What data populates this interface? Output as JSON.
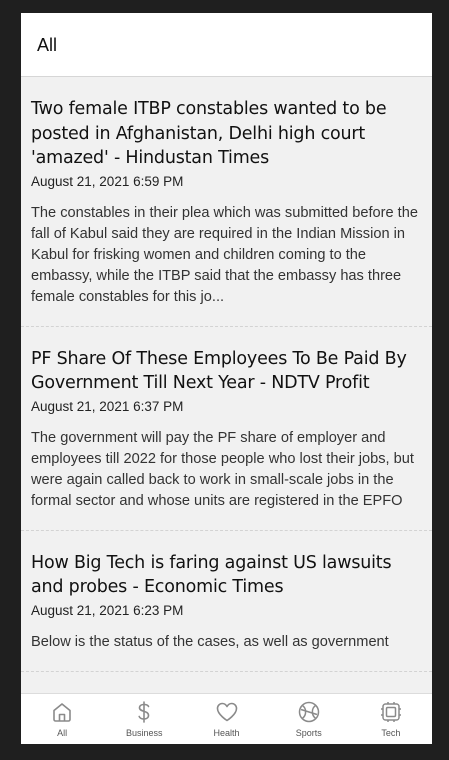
{
  "header": {
    "title": "All"
  },
  "articles": [
    {
      "title": "Two female ITBP constables wanted to be posted in Afghanistan, Delhi high court 'amazed' - Hindustan Times",
      "date": "August 21, 2021 6:59 PM",
      "description": "The constables in their plea which was submitted before the fall of Kabul said they are required in the Indian Mission in Kabul for frisking women and children coming to the embassy, while the ITBP said that the embassy has three female constables for this jo..."
    },
    {
      "title": "PF Share Of These Employees To Be Paid By Government Till Next Year - NDTV Profit",
      "date": "August 21, 2021 6:37 PM",
      "description": "The government will pay the PF share of employer and employees till 2022 for those people who lost their jobs, but were again called back to work in small-scale jobs in the formal sector and whose units are registered in the EPFO"
    },
    {
      "title": "How Big Tech is faring against US lawsuits and probes - Economic Times",
      "date": "August 21, 2021 6:23 PM",
      "description": "Below is the status of the cases, as well as government"
    }
  ],
  "tabs": [
    {
      "label": "All",
      "icon": "home-icon"
    },
    {
      "label": "Business",
      "icon": "dollar-icon"
    },
    {
      "label": "Health",
      "icon": "heart-icon"
    },
    {
      "label": "Sports",
      "icon": "ball-icon"
    },
    {
      "label": "Tech",
      "icon": "chip-icon"
    }
  ],
  "colors": {
    "background": "#f1f1f1",
    "header": "#ffffff",
    "icon": "#8a8a8a"
  }
}
